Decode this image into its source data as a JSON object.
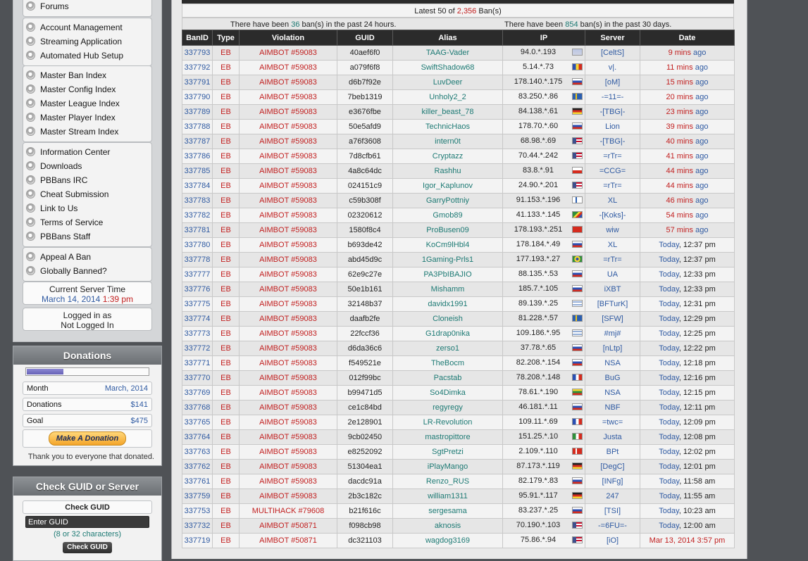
{
  "sidebar": {
    "groups": [
      [
        "Forums"
      ],
      [
        "Account Management",
        "Streaming Application",
        "Automated Hub Setup"
      ],
      [
        "Master Ban Index",
        "Master Config Index",
        "Master League Index",
        "Master Player Index",
        "Master Stream Index"
      ],
      [
        "Information Center",
        "Downloads",
        "PBBans IRC",
        "Cheat Submission",
        "Link to Us",
        "Terms of Service",
        "PBBans Staff"
      ],
      [
        "Appeal A Ban",
        "Globally Banned?"
      ]
    ],
    "server_time_label": "Current Server Time",
    "server_date": "March 14, 2014",
    "server_clock": "1:39 pm",
    "logged_in_label": "Logged in as",
    "logged_in_user": "Not Logged In"
  },
  "donations": {
    "title": "Donations",
    "progress_fraction": 0.3,
    "month_label": "Month",
    "month_value": "March, 2014",
    "donations_label": "Donations",
    "donations_value": "$141",
    "goal_label": "Goal",
    "goal_value": "$475",
    "button_label": "Make A Donation",
    "thanks": "Thank you to everyone that donated."
  },
  "check": {
    "title": "Check GUID or Server",
    "guid_label": "Check GUID",
    "input_value": "Enter GUID",
    "hint": "(8 or 32 characters)",
    "button_label": "Check GUID"
  },
  "summary": {
    "title_prefix": "Latest 50 of ",
    "total": "2,356",
    "title_suffix": " Ban(s)",
    "day_prefix": "There have been ",
    "day_count": "36",
    "day_suffix": " ban(s) in the past 24 hours.",
    "month_prefix": "There have been ",
    "month_count": "854",
    "month_suffix": " ban(s) in the past 30 days."
  },
  "table": {
    "columns": [
      "BanID",
      "Type",
      "Violation",
      "GUID",
      "Alias",
      "IP",
      "Server",
      "Date"
    ],
    "rows": [
      [
        "337793",
        "EB",
        "AIMBOT #59083",
        "40aef6f0",
        "TAAG-Vader",
        "94.0.*.193",
        "gb",
        "[CeltS]",
        "9 mins",
        " ago"
      ],
      [
        "337792",
        "EB",
        "AIMBOT #59083",
        "a079f6f8",
        "SwiftShadow68",
        "5.14.*.73",
        "ro",
        "v|.",
        "11 mins",
        " ago"
      ],
      [
        "337791",
        "EB",
        "AIMBOT #59083",
        "d6b7f92e",
        "LuvDeer",
        "178.140.*.175",
        "ru",
        "[oM]",
        "15 mins",
        " ago"
      ],
      [
        "337790",
        "EB",
        "AIMBOT #59083",
        "7beb1319",
        "Unholy2_2",
        "83.250.*.86",
        "se",
        "-=11=-",
        "20 mins",
        " ago"
      ],
      [
        "337789",
        "EB",
        "AIMBOT #59083",
        "e3676fbe",
        "killer_beast_78",
        "84.138.*.61",
        "de",
        "-[TBG|-",
        "23 mins",
        " ago"
      ],
      [
        "337788",
        "EB",
        "AIMBOT #59083",
        "50e5afd9",
        "TechnicHaos",
        "178.70.*.60",
        "ru",
        "Lion",
        "39 mins",
        " ago"
      ],
      [
        "337787",
        "EB",
        "AIMBOT #59083",
        "a76f3608",
        "intern0t",
        "68.98.*.69",
        "us",
        "-[TBG|-",
        "40 mins",
        " ago"
      ],
      [
        "337786",
        "EB",
        "AIMBOT #59083",
        "7d8cfb61",
        "Cryptazz",
        "70.44.*.242",
        "us",
        "=rTr=",
        "41 mins",
        " ago"
      ],
      [
        "337785",
        "EB",
        "AIMBOT #59083",
        "4a8c64dc",
        "Rashhu",
        "83.8.*.91",
        "pl",
        "=CCG=",
        "44 mins",
        " ago"
      ],
      [
        "337784",
        "EB",
        "AIMBOT #59083",
        "024151c9",
        "Igor_Kaplunov",
        "24.90.*.201",
        "us",
        "=rTr=",
        "44 mins",
        " ago"
      ],
      [
        "337783",
        "EB",
        "AIMBOT #59083",
        "c59b308f",
        "GarryPottniy",
        "91.153.*.196",
        "fi",
        "XL",
        "46 mins",
        " ago"
      ],
      [
        "337782",
        "EB",
        "AIMBOT #59083",
        "02320612",
        "Gmob89",
        "41.133.*.145",
        "za",
        "-[Koks]-",
        "54 mins",
        " ago"
      ],
      [
        "337781",
        "EB",
        "AIMBOT #59083",
        "1580f8c4",
        "ProBusen09",
        "178.193.*.251",
        "ch",
        "wiw",
        "57 mins",
        " ago"
      ],
      [
        "337780",
        "EB",
        "AIMBOT #59083",
        "b693de42",
        "KoCm9lHbl4",
        "178.184.*.49",
        "ru",
        "XL",
        "Today",
        ", 12:37 pm"
      ],
      [
        "337778",
        "EB",
        "AIMBOT #59083",
        "abd45d9c",
        "1Gaming-Prls1",
        "177.193.*.27",
        "br",
        "=rTr=",
        "Today",
        ", 12:37 pm"
      ],
      [
        "337777",
        "EB",
        "AIMBOT #59083",
        "62e9c27e",
        "PA3PbIBAJIO",
        "88.135.*.53",
        "ru",
        "UA",
        "Today",
        ", 12:33 pm"
      ],
      [
        "337776",
        "EB",
        "AIMBOT #59083",
        "50e1b161",
        "Mishamm",
        "185.7.*.105",
        "ru",
        "iXBT",
        "Today",
        ", 12:33 pm"
      ],
      [
        "337775",
        "EB",
        "AIMBOT #59083",
        "32148b37",
        "davidx1991",
        "89.139.*.25",
        "il",
        "[BFTurK]",
        "Today",
        ", 12:31 pm"
      ],
      [
        "337774",
        "EB",
        "AIMBOT #59083",
        "daafb2fe",
        "Cloneish",
        "81.228.*.57",
        "se",
        "[SFW]",
        "Today",
        ", 12:29 pm"
      ],
      [
        "337773",
        "EB",
        "AIMBOT #59083",
        "22fccf36",
        "G1drap0nika",
        "109.186.*.95",
        "il",
        "#mj#",
        "Today",
        ", 12:25 pm"
      ],
      [
        "337772",
        "EB",
        "AIMBOT #59083",
        "d6da36c6",
        "zerso1",
        "37.78.*.65",
        "ru",
        "[nLtp]",
        "Today",
        ", 12:22 pm"
      ],
      [
        "337771",
        "EB",
        "AIMBOT #59083",
        "f549521e",
        "TheBocm",
        "82.208.*.154",
        "ru",
        "NSA",
        "Today",
        ", 12:18 pm"
      ],
      [
        "337770",
        "EB",
        "AIMBOT #59083",
        "012f99bc",
        "Pacstab",
        "78.208.*.148",
        "fr",
        "BuG",
        "Today",
        ", 12:16 pm"
      ],
      [
        "337769",
        "EB",
        "AIMBOT #59083",
        "b99471d5",
        "So4Dimka",
        "78.61.*.190",
        "lt",
        "NSA",
        "Today",
        ", 12:15 pm"
      ],
      [
        "337768",
        "EB",
        "AIMBOT #59083",
        "ce1c84bd",
        "regyregy",
        "46.181.*.11",
        "ru",
        "NBF",
        "Today",
        ", 12:11 pm"
      ],
      [
        "337765",
        "EB",
        "AIMBOT #59083",
        "2e128901",
        "LR-Revolution",
        "109.11.*.69",
        "fr",
        "=twc=",
        "Today",
        ", 12:09 pm"
      ],
      [
        "337764",
        "EB",
        "AIMBOT #59083",
        "9cb02450",
        "mastropittore",
        "151.25.*.10",
        "it",
        "Justa",
        "Today",
        ", 12:08 pm"
      ],
      [
        "337763",
        "EB",
        "AIMBOT #59083",
        "e8252092",
        "SgtPretzi",
        "2.109.*.110",
        "dk",
        "BPt",
        "Today",
        ", 12:02 pm"
      ],
      [
        "337762",
        "EB",
        "AIMBOT #59083",
        "51304ea1",
        "iPlayMango",
        "87.173.*.119",
        "de",
        "[DegC]",
        "Today",
        ", 12:01 pm"
      ],
      [
        "337761",
        "EB",
        "AIMBOT #59083",
        "dacdc91a",
        "Renzo_RUS",
        "82.179.*.83",
        "ru",
        "[INFg]",
        "Today",
        ", 11:58 am"
      ],
      [
        "337759",
        "EB",
        "AIMBOT #59083",
        "2b3c182c",
        "william1311",
        "95.91.*.117",
        "de",
        "247",
        "Today",
        ", 11:55 am"
      ],
      [
        "337753",
        "EB",
        "MULTIHACK #79608",
        "b21f616c",
        "sergesama",
        "83.237.*.25",
        "ru",
        "[TSI]",
        "Today",
        ", 10:23 am"
      ],
      [
        "337732",
        "EB",
        "AIMBOT #50871",
        "f098cb98",
        "aknosis",
        "70.190.*.103",
        "us",
        "-=6FU=-",
        "Today",
        ", 12:00 am"
      ],
      [
        "337719",
        "EB",
        "AIMBOT #50871",
        "dc321103",
        "wagdog3169",
        "75.86.*.94",
        "us",
        "[iO]",
        "Mar 13, 2014",
        " 3:57 pm"
      ]
    ]
  }
}
